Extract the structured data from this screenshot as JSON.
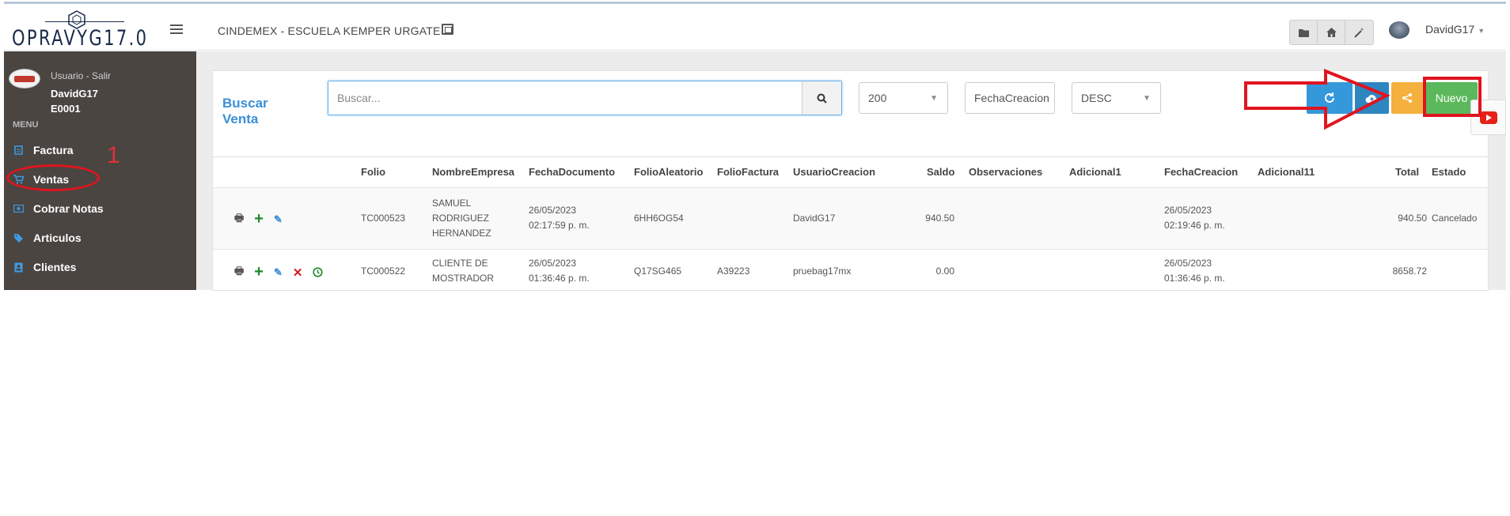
{
  "header": {
    "logo_text": "OPRAVYG17.0",
    "org_title": "CINDEMEX - ESCUELA KEMPER URGATE",
    "user_name": "DavidG17",
    "toolbar_icons": [
      "folder-icon",
      "home-icon",
      "magic-wand-icon"
    ]
  },
  "sidebar": {
    "user_link": "Usuario - Salir",
    "user_name": "DavidG17",
    "user_code": "E0001",
    "menu_label": "MENU",
    "items": [
      {
        "label": "Factura",
        "icon": "invoice-icon"
      },
      {
        "label": "Ventas",
        "icon": "cart-icon"
      },
      {
        "label": "Cobrar Notas",
        "icon": "money-icon"
      },
      {
        "label": "Articulos",
        "icon": "tags-icon"
      },
      {
        "label": "Clientes",
        "icon": "contacts-icon"
      }
    ],
    "annotation_number": "1"
  },
  "main": {
    "title_line1": "Buscar",
    "title_line2": "Venta",
    "search": {
      "placeholder": "Buscar..."
    },
    "page_size": "200",
    "sort_field": "FechaCreacion",
    "sort_order": "DESC",
    "buttons": {
      "nuevo": "Nuevo"
    }
  },
  "table": {
    "columns": [
      "Folio",
      "NombreEmpresa",
      "FechaDocumento",
      "FolioAleatorio",
      "FolioFactura",
      "UsuarioCreacion",
      "Saldo",
      "Observaciones",
      "Adicional1",
      "FechaCreacion",
      "Adicional11",
      "Total",
      "Estado"
    ],
    "rows": [
      {
        "folio": "TC000523",
        "empresa": [
          "SAMUEL",
          "RODRIGUEZ",
          "HERNANDEZ"
        ],
        "fecha_doc": [
          "26/05/2023",
          "02:17:59 p. m."
        ],
        "folio_aleatorio": "6HH6OG54",
        "folio_factura": "",
        "usuario": "DavidG17",
        "saldo": "940.50",
        "observaciones": "",
        "adicional1": "",
        "fecha_creacion": [
          "26/05/2023",
          "02:19:46 p. m."
        ],
        "adicional11": "",
        "total": "940.50",
        "estado": "Cancelado"
      },
      {
        "folio": "TC000522",
        "empresa": [
          "CLIENTE DE",
          "MOSTRADOR"
        ],
        "fecha_doc": [
          "26/05/2023",
          "01:36:46 p. m."
        ],
        "folio_aleatorio": "Q17SG465",
        "folio_factura": "A39223",
        "usuario": "pruebag17mx",
        "saldo": "0.00",
        "observaciones": "",
        "adicional1": "",
        "fecha_creacion": [
          "26/05/2023",
          "01:36:46 p. m."
        ],
        "adicional11": "",
        "total": "8658.72",
        "estado": ""
      }
    ]
  },
  "colors": {
    "sidebar_bg": "#4a4541",
    "accent_blue": "#3b8fd7",
    "refresh_btn": "#3498db",
    "cloud_btn": "#2e86c1",
    "share_btn": "#f4b13e",
    "nuevo_btn": "#5cb85c",
    "annotation_red": "#e0141f"
  }
}
